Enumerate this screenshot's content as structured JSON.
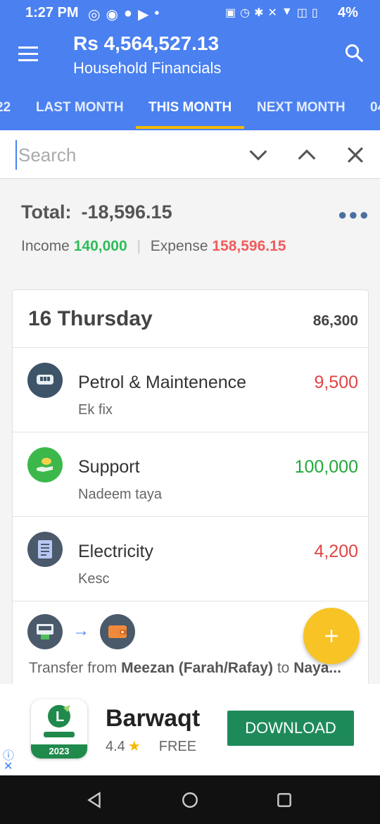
{
  "status_bar": {
    "time": "1:27 PM",
    "battery": "4%",
    "left_icons": [
      "instagram-icon",
      "whatsapp-icon",
      "facebook-icon",
      "youtube-icon",
      "dot-icon"
    ],
    "right_icons": [
      "volte-icon",
      "alarm-icon",
      "bluetooth-icon",
      "mute-icon",
      "wifi-icon",
      "no-sim-icon",
      "battery-icon"
    ]
  },
  "header": {
    "balance": "Rs 4,564,527.13",
    "subtitle": "Household Financials"
  },
  "tabs": [
    {
      "label": "22"
    },
    {
      "label": "LAST MONTH"
    },
    {
      "label": "THIS MONTH"
    },
    {
      "label": "NEXT MONTH"
    },
    {
      "label": "04"
    }
  ],
  "search": {
    "placeholder": "Search"
  },
  "summary": {
    "total_label": "Total:",
    "total_value": "-18,596.15",
    "income_label": "Income",
    "income_value": "140,000",
    "expense_label": "Expense",
    "expense_value": "158,596.15"
  },
  "day": {
    "title": "16 Thursday",
    "total": "86,300"
  },
  "transactions": [
    {
      "name": "Petrol & Maintenence",
      "note": "Ek fix",
      "amount": "9,500",
      "icon": "car-dashboard-icon"
    },
    {
      "name": "Support",
      "note": "Nadeem taya",
      "amount": "100,000",
      "icon": "hand-money-icon"
    },
    {
      "name": "Electricity",
      "note": "Kesc",
      "amount": "4,200",
      "icon": "bill-icon"
    }
  ],
  "transfer": {
    "prefix": "Transfer from",
    "from": "Meezan (Farah/Rafay)",
    "mid": "to",
    "to": "Naya..."
  },
  "ad": {
    "title": "Barwaqt",
    "rating": "4.4",
    "price": "FREE",
    "button": "DOWNLOAD",
    "logo_year": "2023"
  },
  "colors": {
    "primary": "#4a80f0",
    "accent": "#f5b800",
    "income": "#2ebd59",
    "expense": "#f05c5c",
    "ad_button": "#1e8a5a"
  }
}
